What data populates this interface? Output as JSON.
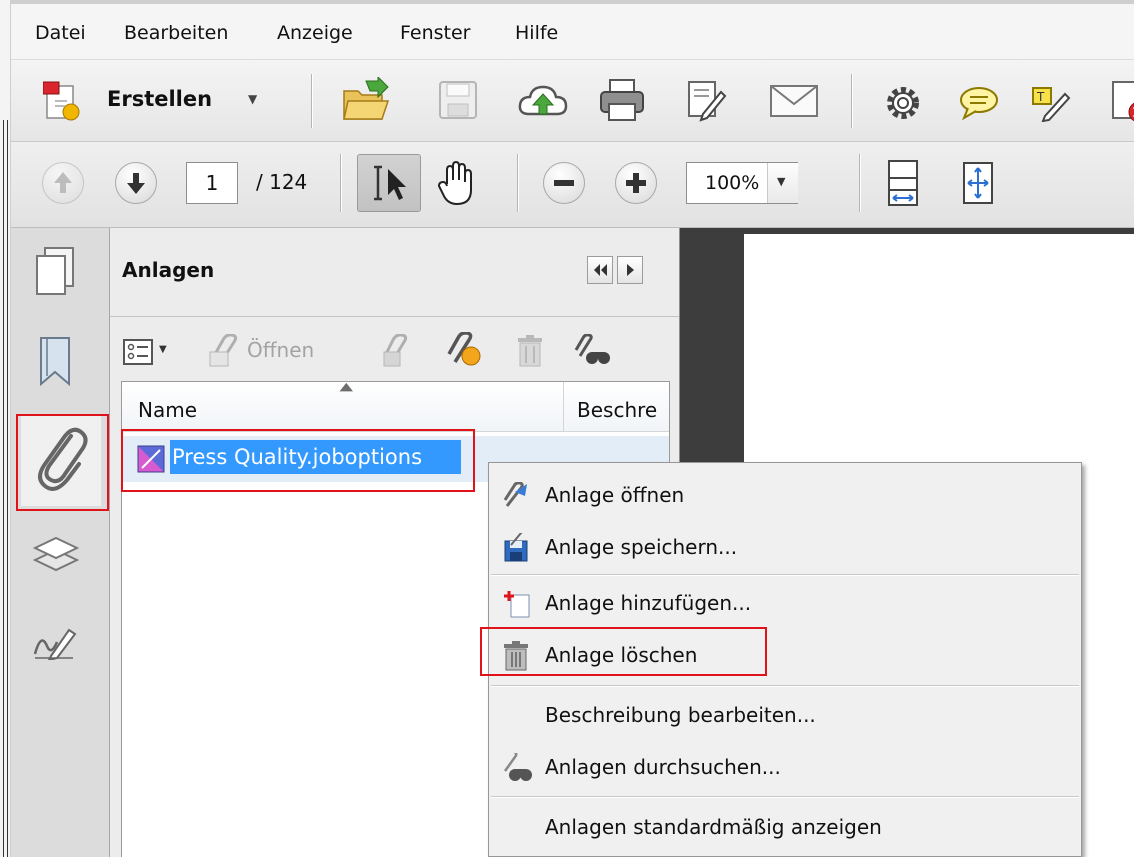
{
  "menubar": {
    "items": [
      "Datei",
      "Bearbeiten",
      "Anzeige",
      "Fenster",
      "Hilfe"
    ]
  },
  "toolbar": {
    "create_label": "Erstellen",
    "page_current": "1",
    "page_total": "/ 124",
    "zoom": "100%"
  },
  "panel": {
    "title": "Anlagen",
    "open_label": "Öffnen",
    "col_name": "Name",
    "col_description": "Beschre",
    "file_name": "Press Quality.joboptions"
  },
  "context_menu": {
    "items": [
      {
        "label": "Anlage öffnen",
        "icon": "attachment-open-icon"
      },
      {
        "label": "Anlage speichern...",
        "icon": "save-attachment-icon"
      },
      {
        "label": "Anlage hinzufügen...",
        "icon": "add-attachment-icon"
      },
      {
        "label": "Anlage löschen",
        "icon": "trash-icon"
      },
      {
        "label": "Beschreibung bearbeiten...",
        "icon": ""
      },
      {
        "label": "Anlagen durchsuchen...",
        "icon": "search-attachments-icon"
      },
      {
        "label": "Anlagen standardmäßig anzeigen",
        "icon": ""
      }
    ]
  },
  "colors": {
    "highlight": "#e0131a",
    "selection": "#3399ff"
  }
}
